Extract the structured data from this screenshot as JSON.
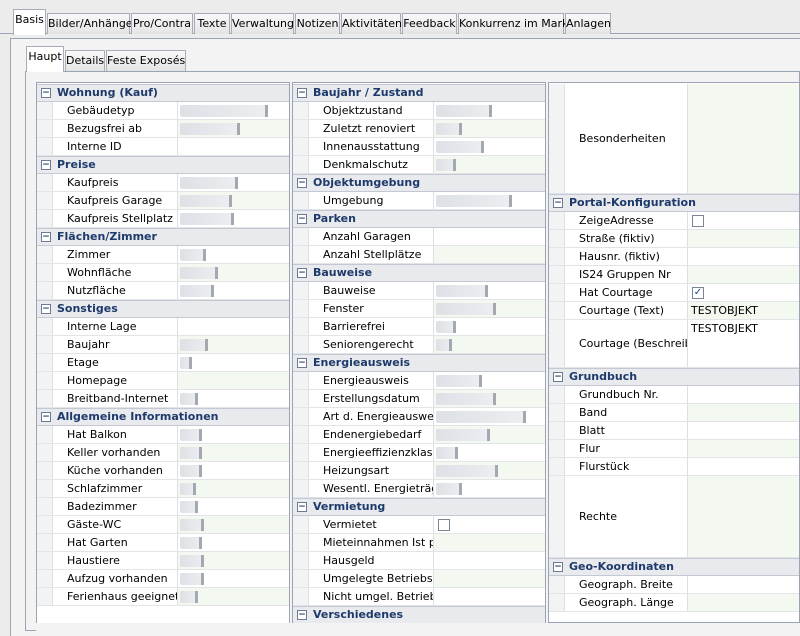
{
  "tabs": [
    "Basis",
    "Bilder/Anhänge",
    "Pro/Contra",
    "Texte",
    "Verwaltung",
    "Notizen",
    "Aktivitäten",
    "Feedback",
    "Konkurrenz im Markt",
    "Anlagen"
  ],
  "subtabs": [
    "Haupt",
    "Details",
    "Feste Exposés"
  ],
  "col1": {
    "groups": [
      {
        "title": "Wohnung (Kauf)",
        "rows": [
          "Gebäudetyp",
          "Bezugsfrei ab",
          "Interne ID"
        ]
      },
      {
        "title": "Preise",
        "rows": [
          "Kaufpreis",
          "Kaufpreis Garage",
          "Kaufpreis Stellplatz"
        ]
      },
      {
        "title": "Flächen/Zimmer",
        "rows": [
          "Zimmer",
          "Wohnfläche",
          "Nutzfläche"
        ]
      },
      {
        "title": "Sonstiges",
        "rows": [
          "Interne Lage",
          "Baujahr",
          "Etage",
          "Homepage",
          "Breitband-Internet"
        ]
      },
      {
        "title": "Allgemeine Informationen",
        "rows": [
          "Hat Balkon",
          "Keller vorhanden",
          "Küche vorhanden",
          "Schlafzimmer",
          "Badezimmer",
          "Gäste-WC",
          "Hat Garten",
          "Haustiere",
          "Aufzug vorhanden",
          "Ferienhaus geeignet"
        ]
      }
    ]
  },
  "col2": {
    "groups": [
      {
        "title": "Baujahr / Zustand",
        "rows": [
          "Objektzustand",
          "Zuletzt renoviert",
          "Innenausstattung",
          "Denkmalschutz"
        ]
      },
      {
        "title": "Objektumgebung",
        "rows": [
          "Umgebung"
        ]
      },
      {
        "title": "Parken",
        "rows": [
          "Anzahl Garagen",
          "Anzahl Stellplätze"
        ]
      },
      {
        "title": "Bauweise",
        "rows": [
          "Bauweise",
          "Fenster",
          "Barrierefrei",
          "Seniorengerecht"
        ]
      },
      {
        "title": "Energieausweis",
        "rows": [
          "Energieausweis",
          "Erstellungsdatum",
          "Art d. Energieausweis",
          "Endenergiebedarf",
          "Energieeffizienzklasse",
          "Heizungsart",
          "Wesentl. Energieträger"
        ]
      },
      {
        "title": "Vermietung",
        "rows": [
          "Vermietet",
          "Mieteinnahmen Ist p.a.",
          "Hausgeld",
          "Umgelegte Betriebskosten",
          "Nicht umgel. Betriebskosten"
        ]
      },
      {
        "title": "Verschiedenes",
        "rows": []
      }
    ]
  },
  "col3": {
    "besonderheiten": "Besonderheiten",
    "groups": [
      {
        "title": "Portal-Konfiguration",
        "rows": [
          "ZeigeAdresse",
          "Straße (fiktiv)",
          "Hausnr. (fiktiv)",
          "IS24 Gruppen Nr",
          "Hat Courtage",
          "Courtage (Text)",
          "Courtage (Beschreibung)"
        ]
      },
      {
        "title": "Grundbuch",
        "rows": [
          "Grundbuch Nr.",
          "Band",
          "Blatt",
          "Flur",
          "Flurstück",
          "Rechte"
        ]
      },
      {
        "title": "Geo-Koordinaten",
        "rows": [
          "Geograph. Breite",
          "Geograph. Länge"
        ]
      }
    ],
    "courtage_text": "TESTOBJEKT",
    "courtage_beschreibung": "TESTOBJEKT",
    "hat_courtage_checked": true,
    "zeige_adresse_checked": false
  },
  "vermietet_checked": false,
  "colors": {
    "group_title": "#1d3a6a",
    "value_alt_bg": "#f3f9f0",
    "border": "#9aa4b4"
  }
}
